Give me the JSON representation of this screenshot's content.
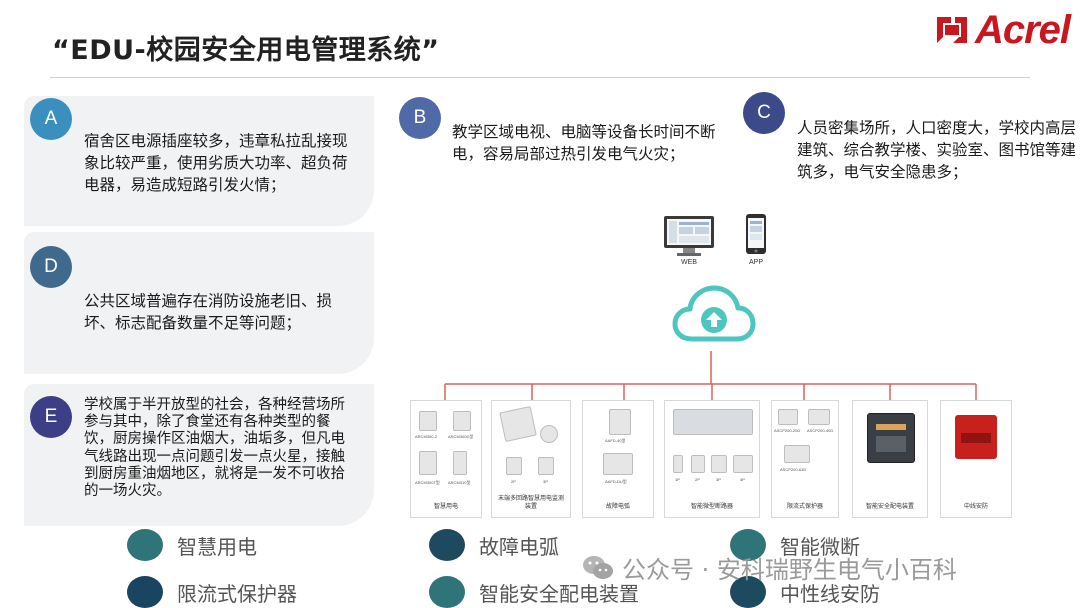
{
  "title": "“EDU-校园安全用电管理系统”",
  "logo": {
    "brand": "Acrel"
  },
  "cards": {
    "a": {
      "badge": "A",
      "text": "宿舍区电源插座较多，违章私拉乱接现象比较严重，使用劣质大功率、超负荷电器，易造成短路引发火情；"
    },
    "b": {
      "badge": "B",
      "text": "教学区域电视、电脑等设备长时间不断电，容易局部过热引发电气火灾；"
    },
    "c": {
      "badge": "C",
      "text": "人员密集场所，人口密度大，学校内高层建筑、综合教学楼、实验室、图书馆等建筑多，电气安全隐患多；"
    },
    "d": {
      "badge": "D",
      "text": "公共区域普遍存在消防设施老旧、损坏、标志配备数量不足等问题；"
    },
    "e": {
      "badge": "E",
      "text": "学校属于半开放型的社会，各种经营场所参与其中，除了食堂还有各种类型的餐饮，厨房操作区油烟大，油垢多，但凡电气线路出现一点问题引发一点火星，接触到厨房重油烟地区，就将是一发不可收拾的一场火灾。"
    }
  },
  "diagram": {
    "web_label": "WEB",
    "app_label": "APP",
    "products": [
      {
        "label": "智慧用电",
        "models": [
          "ARCM300-Z",
          "ARCM300D型",
          "ARCM300T型",
          "ARCM310型"
        ]
      },
      {
        "label": "末端多回路智慧用电监测装置",
        "models": [
          "2P",
          "3P"
        ]
      },
      {
        "label": "故障电弧",
        "models": [
          "AAFD-40型",
          "AAFD-DU型"
        ]
      },
      {
        "label": "智能微型断路器",
        "models": [
          "1P",
          "2P",
          "3P",
          "4P"
        ]
      },
      {
        "label": "限流式保护器",
        "models": [
          "ASCP200-20D",
          "ASCP200-40D",
          "ASCP200-63D"
        ]
      },
      {
        "label": "智能安全配电装置",
        "models": []
      },
      {
        "label": "中线安防",
        "models": []
      }
    ]
  },
  "legend": [
    {
      "label": "智慧用电",
      "color": "#2f7479"
    },
    {
      "label": "故障电弧",
      "color": "#1e4a60"
    },
    {
      "label": "智能微断",
      "color": "#2f7479"
    },
    {
      "label": "限流式保护器",
      "color": "#1a4560"
    },
    {
      "label": "智能安全配电装置",
      "color": "#2f7479"
    },
    {
      "label": "中性线安防",
      "color": "#1e4a60"
    }
  ],
  "watermark": "公众号 · 安科瑞野生电气小百科",
  "colors": {
    "badge_a": "#3b8fbf",
    "badge_b": "#4f6aa6",
    "badge_c": "#3c4a8a",
    "badge_d": "#3f6a8e",
    "badge_e": "#3c3e86",
    "brand_red": "#c8171e",
    "cloud": "#4dc6bf",
    "connector": "#d9625a"
  }
}
